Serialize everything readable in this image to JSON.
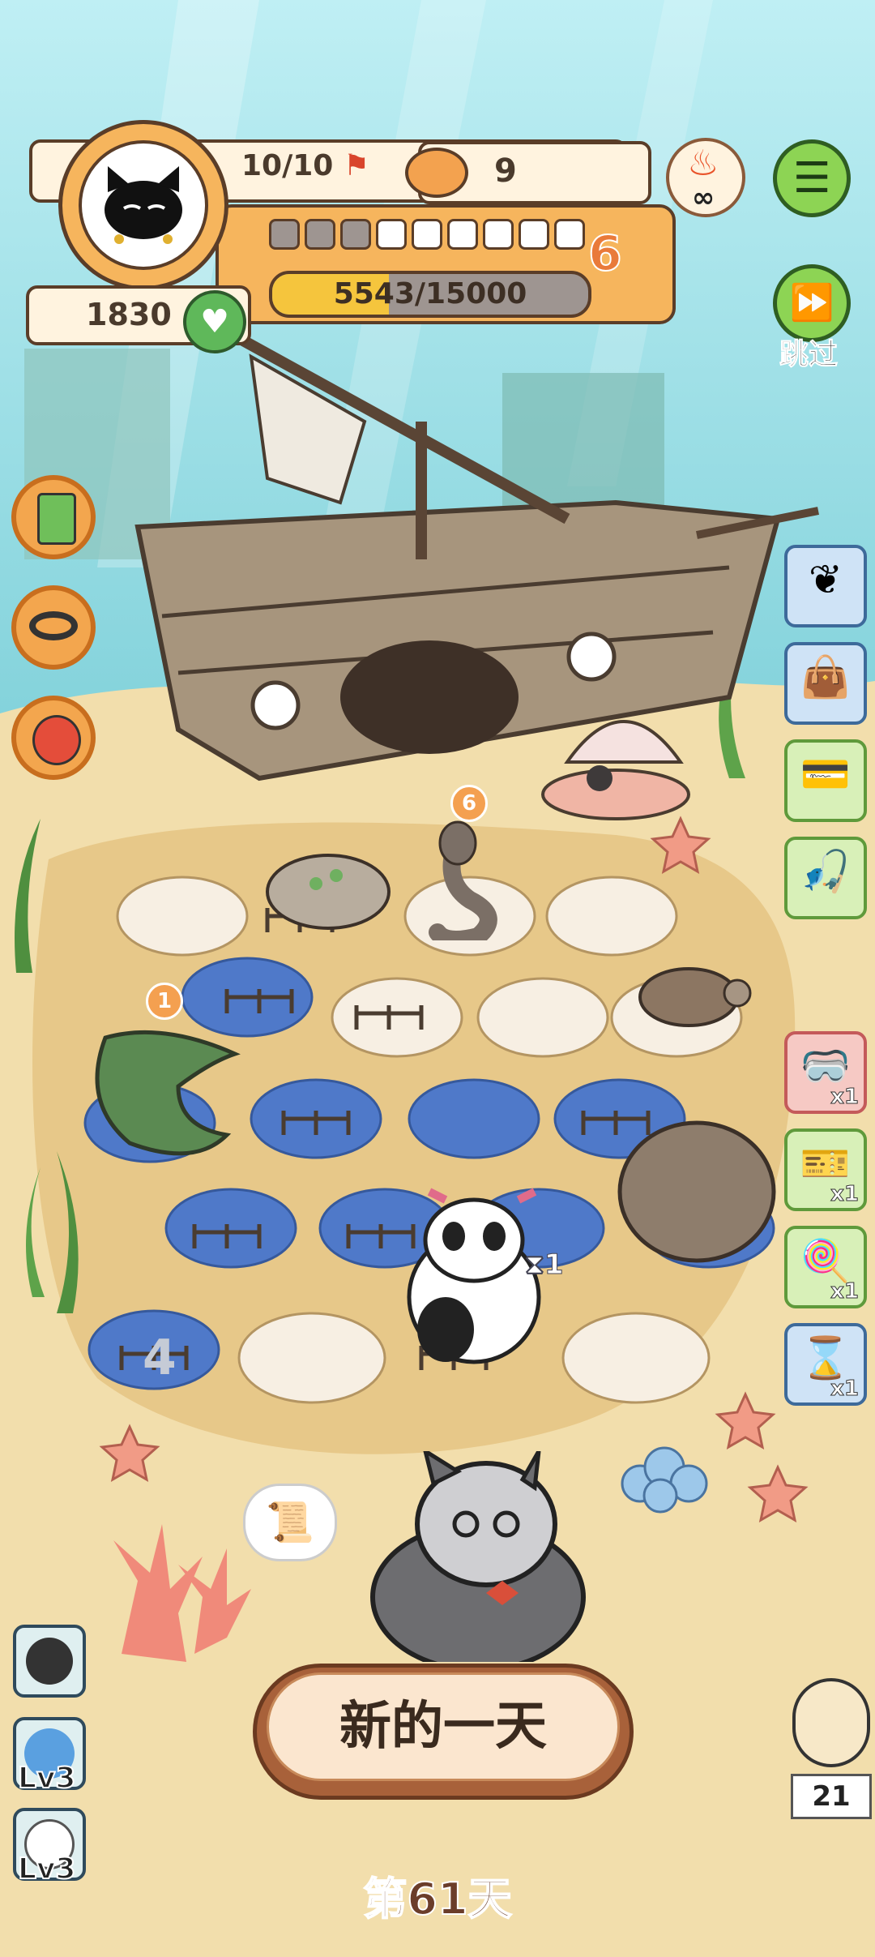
{
  "hud": {
    "hearts": "10/10",
    "bowls": "9",
    "coins": "1830",
    "level": "6",
    "exp_text": "5543/15000",
    "exp_fraction": 0.37,
    "level_segments_filled": 3,
    "level_segments_total": 9
  },
  "top_right": {
    "infinity": "∞",
    "skip_label": "跳过"
  },
  "left_buttons": [
    {
      "icon": "calculator-icon"
    },
    {
      "icon": "collar-icon"
    },
    {
      "icon": "lucky-cat-icon"
    }
  ],
  "right_items": [
    {
      "icon": "wings-icon",
      "count": ""
    },
    {
      "icon": "bag-icon",
      "count": ""
    },
    {
      "icon": "card-icon",
      "count": ""
    },
    {
      "icon": "fishing-rod-icon",
      "count": ""
    },
    {
      "icon": "snorkel-mask-icon",
      "count": "x1"
    },
    {
      "icon": "ticket-icon",
      "count": "x1"
    },
    {
      "icon": "lollipop-icon",
      "count": "x1"
    },
    {
      "icon": "hourglass-icon",
      "count": "x1"
    }
  ],
  "board": {
    "snake_badge": "6",
    "croc_badge": "1",
    "hourglass_timer": "1",
    "tile_number": "4"
  },
  "skills": [
    {
      "label": ""
    },
    {
      "label": "Lv3"
    },
    {
      "label": "Lv3"
    }
  ],
  "main_button": "新的一天",
  "day_label": "第61天",
  "owl_count": "21"
}
